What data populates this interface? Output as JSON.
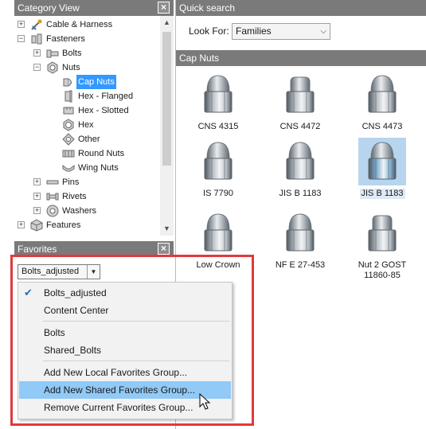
{
  "category_view": {
    "title": "Category View",
    "close_glyph": "×",
    "items": [
      {
        "label": "Cable & Harness",
        "icon": "cable-icon",
        "expander": "+"
      },
      {
        "label": "Fasteners",
        "icon": "fasteners-icon",
        "expander": "−"
      },
      {
        "label": "Bolts",
        "icon": "bolt-icon",
        "expander": "+"
      },
      {
        "label": "Nuts",
        "icon": "nut-icon",
        "expander": "−"
      },
      {
        "label": "Cap Nuts",
        "icon": "cap-nut-icon",
        "selected": true
      },
      {
        "label": "Hex - Flanged",
        "icon": "flanged-nut-icon"
      },
      {
        "label": "Hex - Slotted",
        "icon": "slotted-nut-icon"
      },
      {
        "label": "Hex",
        "icon": "hex-nut-icon"
      },
      {
        "label": "Other",
        "icon": "other-nut-icon"
      },
      {
        "label": "Round Nuts",
        "icon": "round-nut-icon"
      },
      {
        "label": "Wing Nuts",
        "icon": "wing-nut-icon"
      },
      {
        "label": "Pins",
        "icon": "pin-icon",
        "expander": "+"
      },
      {
        "label": "Rivets",
        "icon": "rivet-icon",
        "expander": "+"
      },
      {
        "label": "Washers",
        "icon": "washer-icon",
        "expander": "+"
      },
      {
        "label": "Features",
        "icon": "features-icon",
        "expander": "+"
      }
    ]
  },
  "favorites": {
    "title": "Favorites",
    "close_glyph": "×",
    "selected_group": "Bolts_adjusted",
    "caret": "▼"
  },
  "quick_search": {
    "title": "Quick search",
    "look_for_label": "Look For:",
    "look_for_value": "Families",
    "caret": "⌵"
  },
  "grid": {
    "title": "Cap Nuts",
    "parts": [
      {
        "label": "CNS 4315",
        "shape": "dome"
      },
      {
        "label": "CNS 4472",
        "shape": "flat"
      },
      {
        "label": "CNS 4473",
        "shape": "dome"
      },
      {
        "label": "IS 7790",
        "shape": "dome"
      },
      {
        "label": "JIS B 1183",
        "shape": "dome"
      },
      {
        "label": "JIS B 1183",
        "shape": "dome",
        "selected": true
      },
      {
        "label": "Low Crown",
        "shape": "dome"
      },
      {
        "label": "NF E 27-453",
        "shape": "dome"
      },
      {
        "label": "Nut 2 GOST 11860-85",
        "shape": "flat"
      }
    ]
  },
  "menu": {
    "items": [
      {
        "label": "Bolts_adjusted",
        "checked": true
      },
      {
        "label": "Content Center"
      },
      {
        "label": "Bolts"
      },
      {
        "label": "Shared_Bolts"
      },
      {
        "label": "Add New Local Favorites Group..."
      },
      {
        "label": "Add New Shared Favorites Group...",
        "highlighted": true
      },
      {
        "label": "Remove Current Favorites Group..."
      }
    ],
    "check_glyph": "✔"
  },
  "colors": {
    "header_bg": "#7a7a7a",
    "selection_blue": "#3399ff",
    "menu_highlight": "#91c9f7",
    "annotation_red": "#e2393b"
  }
}
